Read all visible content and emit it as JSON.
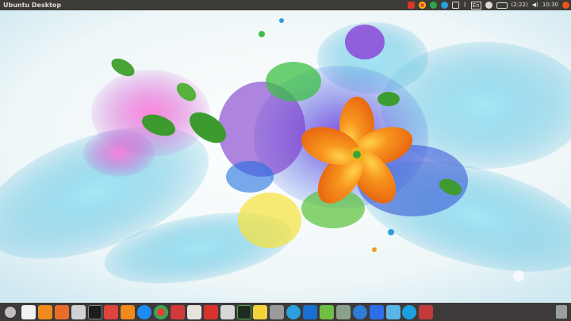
{
  "topbar": {
    "title": "Ubuntu Desktop",
    "battery": "(2:22)",
    "clock": "10:30",
    "keyboard": "En"
  },
  "icons": {
    "tray": [
      "gmail-icon",
      "chrome-icon",
      "circle-icon",
      "telegram-icon",
      "wifi-icon",
      "bluetooth-icon",
      "keyboard-icon",
      "chat-icon",
      "battery-icon",
      "volume-icon",
      "power-icon"
    ],
    "dock": [
      "launcher-icon",
      "apps-grid-icon",
      "files-icon",
      "software-center-icon",
      "rack-icon",
      "terminal-icon",
      "slack-icon",
      "vlc-icon",
      "messenger-icon",
      "chrome-icon",
      "screenshot-icon",
      "reader-icon",
      "popcorn-icon",
      "camera-icon",
      "system-monitor-icon",
      "notes-icon",
      "disk-icon",
      "telegram-icon",
      "teamviewer-icon",
      "upwork-icon",
      "home-icon",
      "chromium-icon",
      "blue-app-icon",
      "window-icon",
      "skype-icon",
      "shutter-icon",
      "trash-icon"
    ]
  },
  "colors": {
    "panel": "#3c3b37",
    "dock": "#3e3a3a",
    "flower_orange": "#f2861a",
    "accent_teal": "#2ab4d8",
    "accent_purple": "#8a3fd6"
  }
}
